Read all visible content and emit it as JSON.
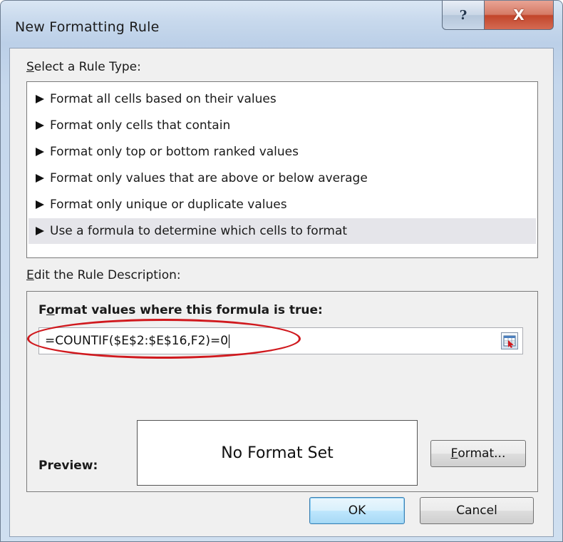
{
  "window": {
    "title": "New Formatting Rule",
    "help_glyph": "?",
    "close_glyph": "X"
  },
  "rule_type": {
    "label_prefix": "",
    "label_accel": "S",
    "label_rest": "elect a Rule Type:",
    "items": [
      {
        "label": "Format all cells based on their values"
      },
      {
        "label": "Format only cells that contain"
      },
      {
        "label": "Format only top or bottom ranked values"
      },
      {
        "label": "Format only values that are above or below average"
      },
      {
        "label": "Format only unique or duplicate values"
      },
      {
        "label": "Use a formula to determine which cells to format"
      }
    ],
    "selected_index": 5
  },
  "description": {
    "label_accel": "E",
    "label_rest": "dit the Rule Description:",
    "formula_label_pre": "F",
    "formula_label_accel": "o",
    "formula_label_rest": "rmat values where this formula is true:",
    "formula_value": "=COUNTIF($E$2:$E$16,F2)=0",
    "preview_label": "Preview:",
    "preview_text": "No Format Set",
    "format_button_accel": "F",
    "format_button_rest": "ormat..."
  },
  "buttons": {
    "ok": "OK",
    "cancel": "Cancel"
  },
  "colors": {
    "annotation_ellipse": "#d0191e",
    "selected_row": "#e5e5ea",
    "close_button": "#c2452b"
  },
  "icons": {
    "list_bullet": "right-triangle-icon",
    "collapse_dialog": "collapse-dialog-icon"
  }
}
